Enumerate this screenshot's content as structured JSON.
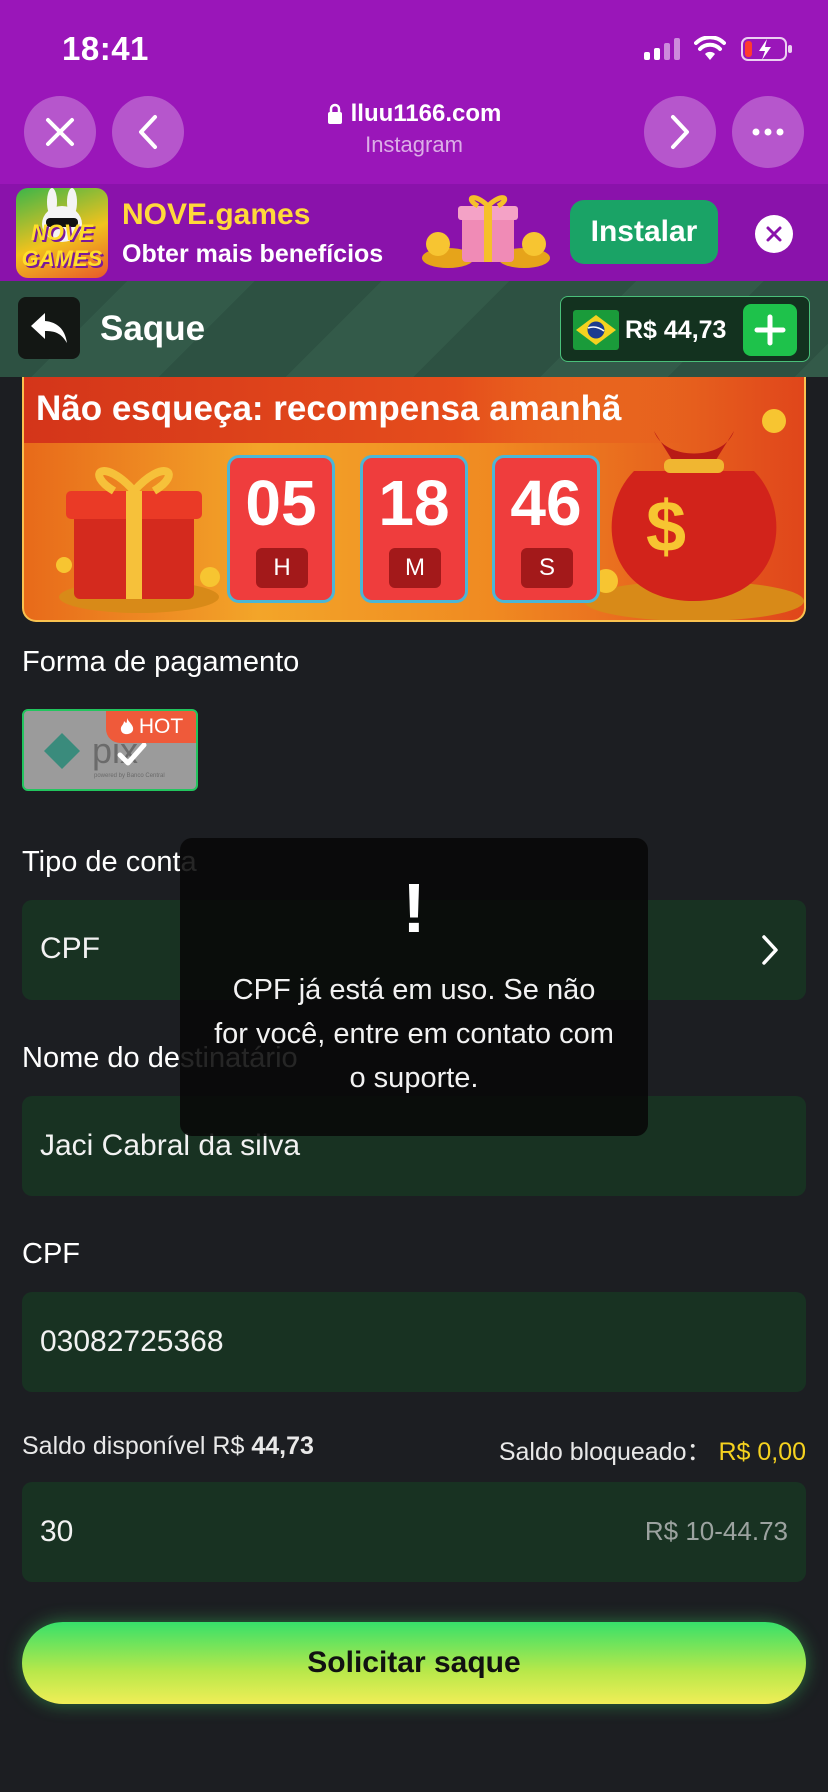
{
  "status_bar": {
    "time": "18:41"
  },
  "browser": {
    "url": "lluu1166.com",
    "source": "Instagram"
  },
  "install_banner": {
    "icon_text": "NOVE GAMES",
    "title": "NOVE.games",
    "subtitle": "Obter mais benefícios",
    "install_label": "Instalar"
  },
  "header": {
    "title": "Saque",
    "balance": "R$ 44,73"
  },
  "reward": {
    "title": "Não esqueça: recompensa amanhã",
    "timer": [
      {
        "value": "05",
        "unit": "H"
      },
      {
        "value": "18",
        "unit": "M"
      },
      {
        "value": "46",
        "unit": "S"
      }
    ]
  },
  "form": {
    "payment_label": "Forma de pagamento",
    "pix_label": "pix",
    "pix_sub": "powered by Banco Central",
    "hot_badge": "HOT",
    "account_type_label": "Tipo de conta",
    "account_type_value": "CPF",
    "recipient_label": "Nome do destinatário",
    "recipient_value": "Jaci Cabral da silva",
    "cpf_label": "CPF",
    "cpf_value": "03082725368",
    "saldo_disponivel_label": "Saldo disponível R$",
    "saldo_disponivel_value": "44,73",
    "saldo_bloqueado_label": "Saldo bloqueado：",
    "saldo_bloqueado_value": "R$ 0,00",
    "amount_value": "30",
    "amount_range": "R$ 10-44.73",
    "submit_label": "Solicitar saque"
  },
  "toast": {
    "icon": "!",
    "message": "CPF já está em uso. Se não for você, entre em contato com o suporte."
  },
  "colors": {
    "chrome": "#9a16b9",
    "field_bg": "#183222",
    "accent_green": "#1ec24b",
    "highlight_yellow": "#f5d21f",
    "timer_red": "#ef3d3d"
  }
}
